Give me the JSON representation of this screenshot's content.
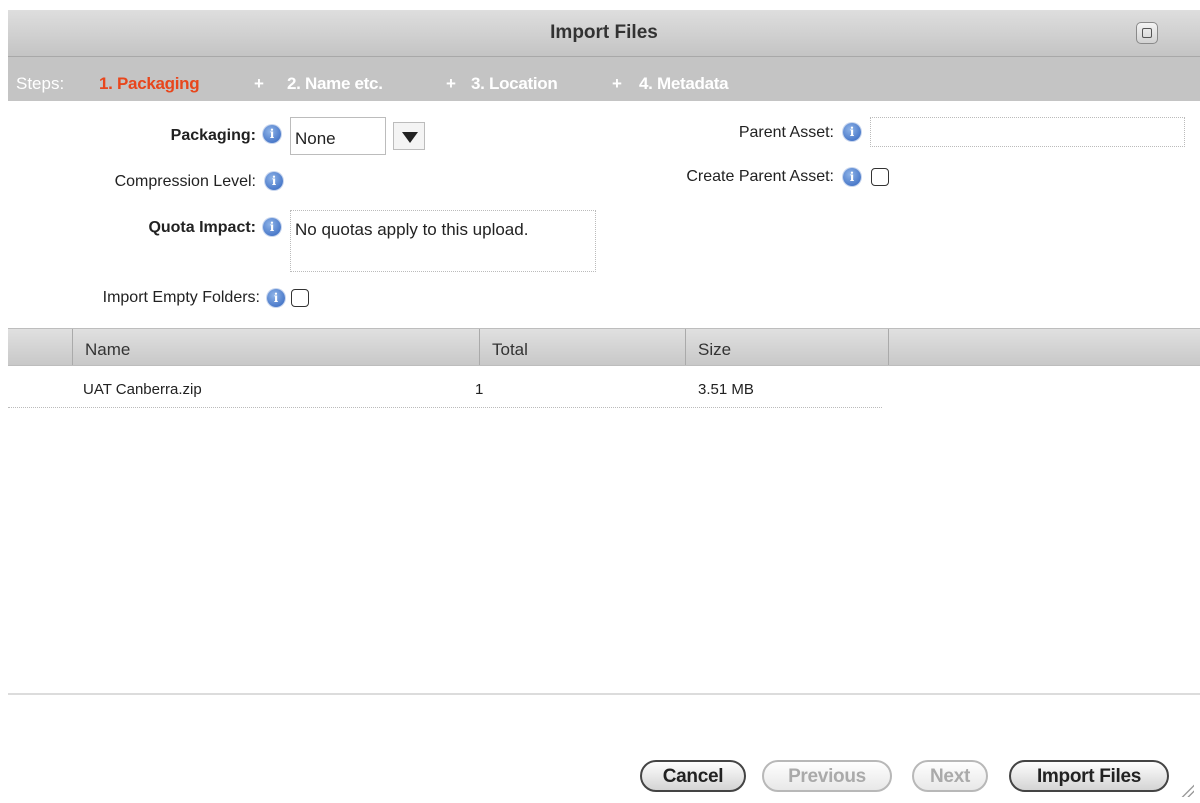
{
  "dialog": {
    "title": "Import Files"
  },
  "steps": {
    "label": "Steps:",
    "items": [
      "1. Packaging",
      "2. Name etc.",
      "3. Location",
      "4. Metadata"
    ],
    "separator": "+"
  },
  "form": {
    "packaging": {
      "label": "Packaging:",
      "value": "None"
    },
    "compression_level": {
      "label": "Compression Level:"
    },
    "quota_impact": {
      "label": "Quota Impact:",
      "value": "No quotas apply to this upload."
    },
    "import_empty_folders": {
      "label": "Import Empty Folders:",
      "checked": false
    },
    "parent_asset": {
      "label": "Parent Asset:",
      "value": ""
    },
    "create_parent_asset": {
      "label": "Create Parent Asset:",
      "checked": false
    },
    "info_glyph": "i"
  },
  "grid": {
    "columns": [
      "Name",
      "Total",
      "Size"
    ],
    "rows": [
      {
        "name": "UAT Canberra.zip",
        "total": "1",
        "size": "3.51 MB"
      }
    ]
  },
  "buttons": {
    "cancel": "Cancel",
    "previous": "Previous",
    "next": "Next",
    "import": "Import Files"
  },
  "colors": {
    "active_step": "#e8461c",
    "header_bg": "#c4c4c4"
  }
}
